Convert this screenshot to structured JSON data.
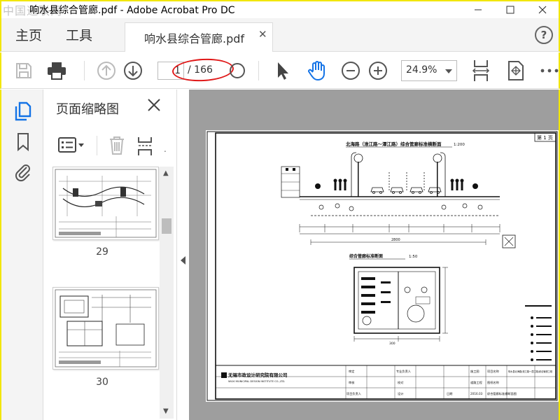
{
  "window": {
    "title": "响水县综合管廊.pdf - Adobe Acrobat Pro DC",
    "watermark": "中国通联网"
  },
  "nav": {
    "home": "主页",
    "tools": "工具",
    "tab_label": "响水县综合管廊.pdf",
    "close_glyph": "✕",
    "help_glyph": "?"
  },
  "toolbar": {
    "page_current": "1",
    "page_total": "/ 166",
    "zoom": "24.9%"
  },
  "panel": {
    "title": "页面缩略图",
    "thumbnails": [
      {
        "number": "29"
      },
      {
        "number": "30"
      }
    ]
  },
  "drawing": {
    "main_title": "北海路（淮江路～潭江路）综合管廊标准横断面",
    "scale_main": "1:200",
    "section_title": "综合管廊标准断面",
    "section_scale": "1:50",
    "dimension_total": "2800",
    "dimension_bottom": "300",
    "company_name": "无锡市政设计研究院有限公司",
    "company_name_en": "WUXI MUNICIPAL DESIGN INSTITUTE CO.,LTD.",
    "sheet_label": "第 1 页",
    "date": "2016.03",
    "title_block": {
      "review": "审定",
      "check": "审核",
      "lead": "项目负责人",
      "major": "专业负责人",
      "verify": "校对",
      "design": "设计",
      "stage": "施工图",
      "project_label": "项目名称",
      "project_name": "响水县北海路(淮江路～潭江路)综合管廊工程",
      "drawing_label": "图纸名称",
      "drawing_name": "综合管廊标准横断面图",
      "dept": "道路工程",
      "date_label": "日期"
    }
  },
  "colors": {
    "accent_blue": "#1473e6",
    "highlight_red": "#e01919",
    "frame_yellow": "#f2e600"
  }
}
